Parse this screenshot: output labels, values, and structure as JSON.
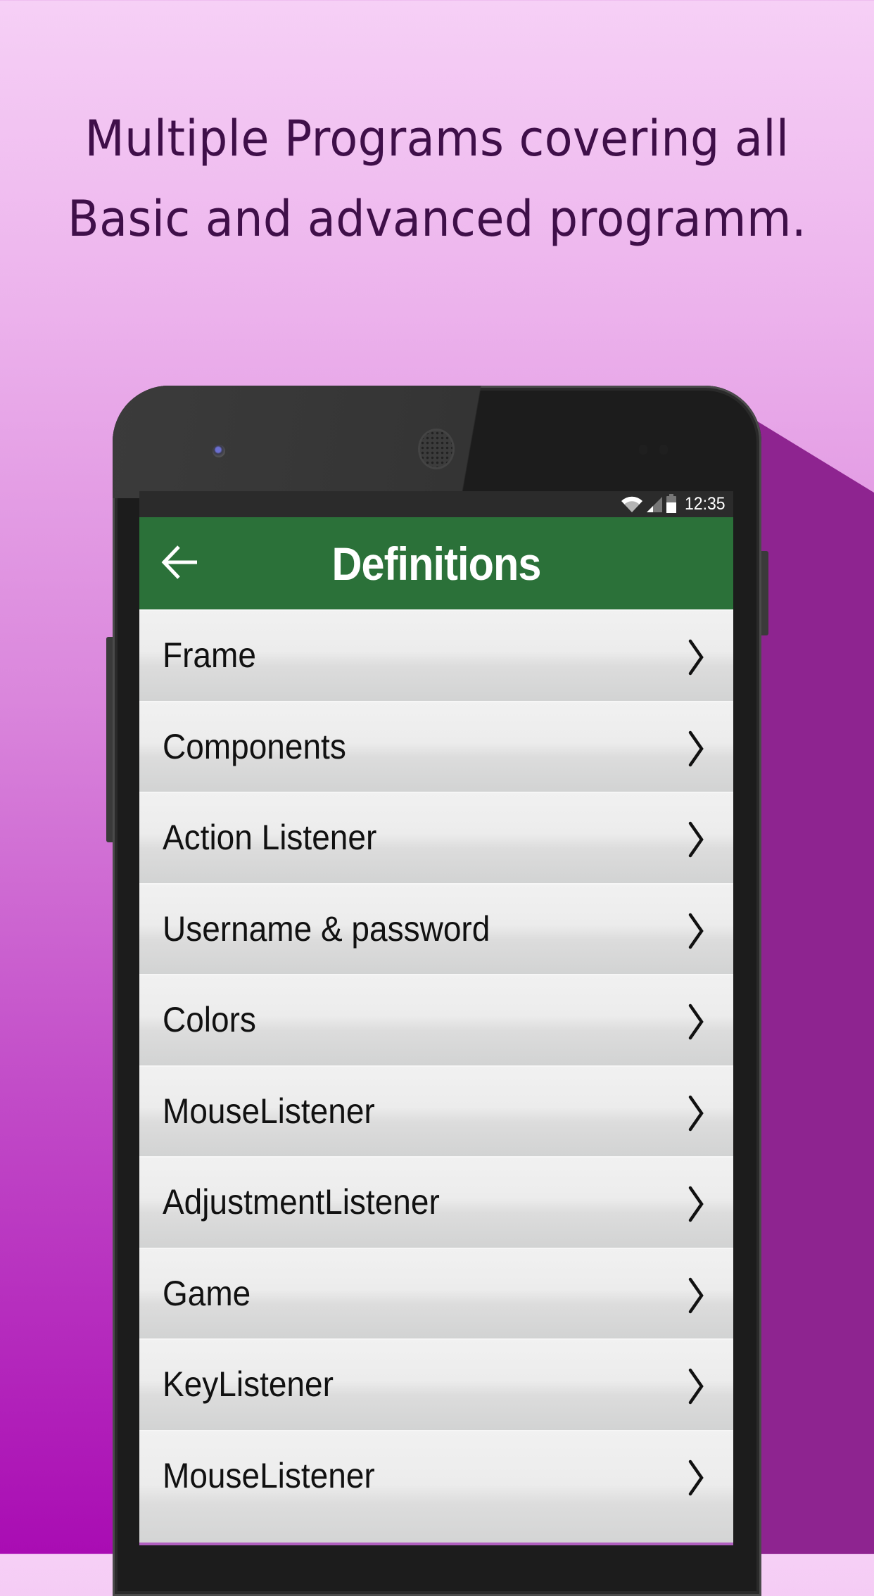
{
  "headline": {
    "line1": "Multiple Programs covering all",
    "line2": "Basic and advanced programm."
  },
  "colors": {
    "app_bar": "#2b7139",
    "headline_text": "#3f0f49",
    "background_top": "#f6d0f6",
    "background_bottom": "#a90cb3",
    "accent_shadow": "#8e2490"
  },
  "status_bar": {
    "time": "12:35",
    "icons": [
      "wifi-icon",
      "cellular-signal-icon",
      "battery-icon"
    ]
  },
  "app_bar": {
    "title": "Definitions",
    "back_icon": "arrow-left-icon"
  },
  "list": {
    "items": [
      {
        "label": "Frame"
      },
      {
        "label": "Components"
      },
      {
        "label": "Action Listener"
      },
      {
        "label": "Username & password"
      },
      {
        "label": "Colors"
      },
      {
        "label": "MouseListener"
      },
      {
        "label": "AdjustmentListener"
      },
      {
        "label": "Game"
      },
      {
        "label": "KeyListener"
      },
      {
        "label": "MouseListener"
      }
    ],
    "trailing_icon": "chevron-right-icon"
  }
}
